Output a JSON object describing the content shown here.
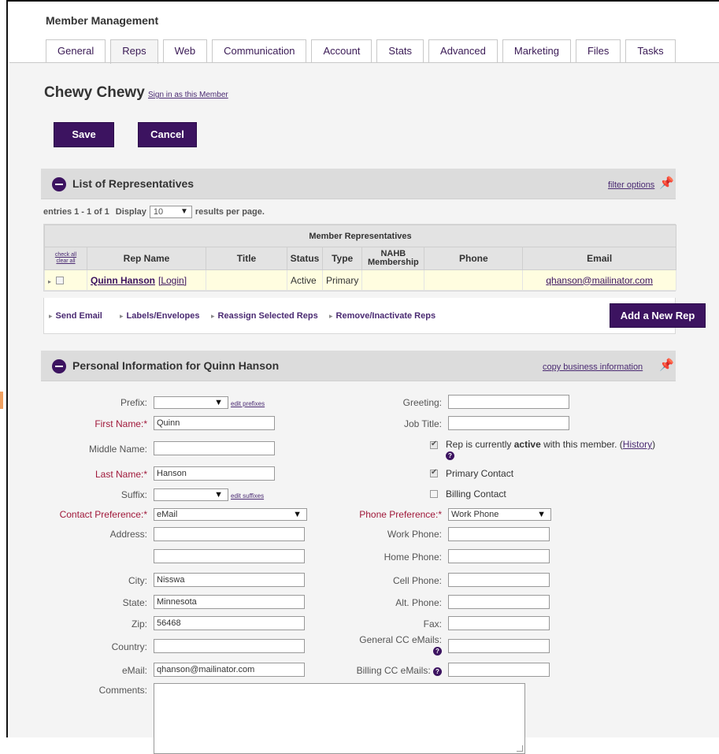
{
  "header": {
    "title": "Member Management"
  },
  "tabs": [
    {
      "label": "General"
    },
    {
      "label": "Reps"
    },
    {
      "label": "Web"
    },
    {
      "label": "Communication"
    },
    {
      "label": "Account"
    },
    {
      "label": "Stats"
    },
    {
      "label": "Advanced"
    },
    {
      "label": "Marketing"
    },
    {
      "label": "Files"
    },
    {
      "label": "Tasks"
    }
  ],
  "member": {
    "name": "Chewy Chewy",
    "sign_in_link": "Sign in as this Member"
  },
  "buttons": {
    "save": "Save",
    "cancel": "Cancel",
    "add_rep": "Add a New Rep"
  },
  "reps_section": {
    "title": "List of Representatives",
    "filter_link": "filter options",
    "entries_text": "entries 1 - 1 of 1",
    "display_label": "Display",
    "per_page_value": "10",
    "per_page_suffix": "results per page.",
    "table_caption": "Member Representatives",
    "check_all": "check all",
    "clear_all": "clear all",
    "columns": [
      "Rep Name",
      "Title",
      "Status",
      "Type",
      "NAHB Membership",
      "Phone",
      "Email"
    ],
    "rows": [
      {
        "name": "Quinn Hanson",
        "login": "[Login]",
        "title": "",
        "status": "Active",
        "type": "Primary",
        "nahb": "",
        "phone": "",
        "email": "qhanson@mailinator.com"
      }
    ],
    "actions": [
      "Send Email",
      "Labels/Envelopes",
      "Reassign Selected Reps",
      "Remove/Inactivate Reps"
    ]
  },
  "personal_section": {
    "title": "Personal Information for Quinn Hanson",
    "copy_link": "copy business information",
    "left": {
      "prefix_label": "Prefix:",
      "edit_prefixes": "edit prefixes",
      "first_name_label": "First Name:*",
      "first_name": "Quinn",
      "middle_name_label": "Middle Name:",
      "middle_name": "",
      "last_name_label": "Last Name:*",
      "last_name": "Hanson",
      "suffix_label": "Suffix:",
      "edit_suffixes": "edit suffixes",
      "contact_pref_label": "Contact Preference:*",
      "contact_pref": "eMail",
      "address_label": "Address:",
      "city_label": "City:",
      "city": "Nisswa",
      "state_label": "State:",
      "state": "Minnesota",
      "zip_label": "Zip:",
      "zip": "56468",
      "country_label": "Country:",
      "email_label": "eMail:",
      "email": "qhanson@mailinator.com",
      "comments_label": "Comments:"
    },
    "right": {
      "greeting_label": "Greeting:",
      "job_title_label": "Job Title:",
      "active_text_1": "Rep is currently",
      "active_text_bold": "active",
      "active_text_2": "with this member. (",
      "history_link": "History",
      "active_text_3": ")",
      "primary_contact": "Primary Contact",
      "billing_contact": "Billing Contact",
      "phone_pref_label": "Phone Preference:*",
      "phone_pref": "Work Phone",
      "work_phone_label": "Work Phone:",
      "home_phone_label": "Home Phone:",
      "cell_phone_label": "Cell Phone:",
      "alt_phone_label": "Alt. Phone:",
      "fax_label": "Fax:",
      "general_cc_label": "General CC eMails:",
      "billing_cc_label": "Billing CC eMails:"
    }
  },
  "icons": {
    "help": "?",
    "pin": "★",
    "dropdown": "▼"
  },
  "colors": {
    "accent": "#3c1360",
    "required": "#a0183a",
    "row_highlight": "#fffde0"
  }
}
